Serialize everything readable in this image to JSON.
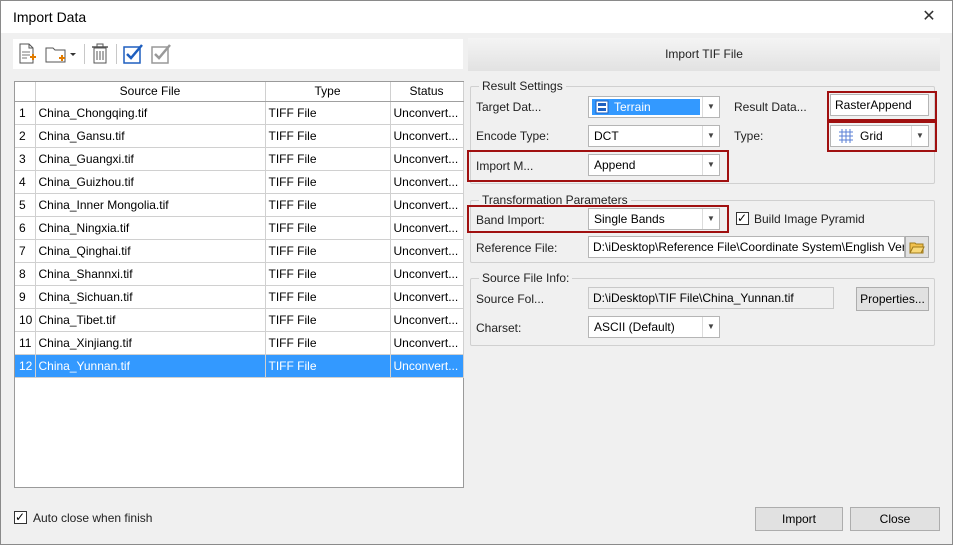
{
  "window": {
    "title": "Import Data",
    "close_glyph": "✕"
  },
  "toolbar": {
    "icons": [
      "add-file-icon",
      "add-folder-icon",
      "delete-icon",
      "select-all-icon",
      "invert-select-icon"
    ]
  },
  "grid": {
    "columns": [
      "",
      "Source File",
      "Type",
      "Status"
    ],
    "rows": [
      {
        "num": "1",
        "file": "China_Chongqing.tif",
        "type": "TIFF File",
        "status": "Unconvert..."
      },
      {
        "num": "2",
        "file": "China_Gansu.tif",
        "type": "TIFF File",
        "status": "Unconvert..."
      },
      {
        "num": "3",
        "file": "China_Guangxi.tif",
        "type": "TIFF File",
        "status": "Unconvert..."
      },
      {
        "num": "4",
        "file": "China_Guizhou.tif",
        "type": "TIFF File",
        "status": "Unconvert..."
      },
      {
        "num": "5",
        "file": "China_Inner Mongolia.tif",
        "type": "TIFF File",
        "status": "Unconvert..."
      },
      {
        "num": "6",
        "file": "China_Ningxia.tif",
        "type": "TIFF File",
        "status": "Unconvert..."
      },
      {
        "num": "7",
        "file": "China_Qinghai.tif",
        "type": "TIFF File",
        "status": "Unconvert..."
      },
      {
        "num": "8",
        "file": "China_Shannxi.tif",
        "type": "TIFF File",
        "status": "Unconvert..."
      },
      {
        "num": "9",
        "file": "China_Sichuan.tif",
        "type": "TIFF File",
        "status": "Unconvert..."
      },
      {
        "num": "10",
        "file": "China_Tibet.tif",
        "type": "TIFF File",
        "status": "Unconvert..."
      },
      {
        "num": "11",
        "file": "China_Xinjiang.tif",
        "type": "TIFF File",
        "status": "Unconvert..."
      },
      {
        "num": "12",
        "file": "China_Yunnan.tif",
        "type": "TIFF File",
        "status": "Unconvert..."
      }
    ],
    "selected_index": 11
  },
  "panel": {
    "header": "Import TIF File",
    "result_settings": {
      "label": "Result Settings",
      "target_label": "Target Dat...",
      "target_value": "Terrain",
      "result_label": "Result Data...",
      "result_value": "RasterAppend",
      "encode_label": "Encode Type:",
      "encode_value": "DCT",
      "type_label": "Type:",
      "type_value": "Grid",
      "import_mode_label": "Import M...",
      "import_mode_value": "Append"
    },
    "transformation": {
      "label": "Transformation Parameters",
      "band_label": "Band Import:",
      "band_value": "Single Bands",
      "pyramid_label": "Build Image Pyramid",
      "pyramid_checked": true,
      "reference_label": "Reference File:",
      "reference_value": "D:\\iDesktop\\Reference File\\Coordinate System\\English Version"
    },
    "source_info": {
      "label": "Source File Info:",
      "folder_label": "Source Fol...",
      "folder_value": "D:\\iDesktop\\TIF File\\China_Yunnan.tif",
      "properties_label": "Properties...",
      "charset_label": "Charset:",
      "charset_value": "ASCII (Default)"
    }
  },
  "footer": {
    "auto_close_label": "Auto close when finish",
    "auto_close_checked": true,
    "import_label": "Import",
    "close_label": "Close"
  },
  "colors": {
    "selection": "#3399ff",
    "highlight": "#a01010",
    "check": "#1f5fbf"
  }
}
